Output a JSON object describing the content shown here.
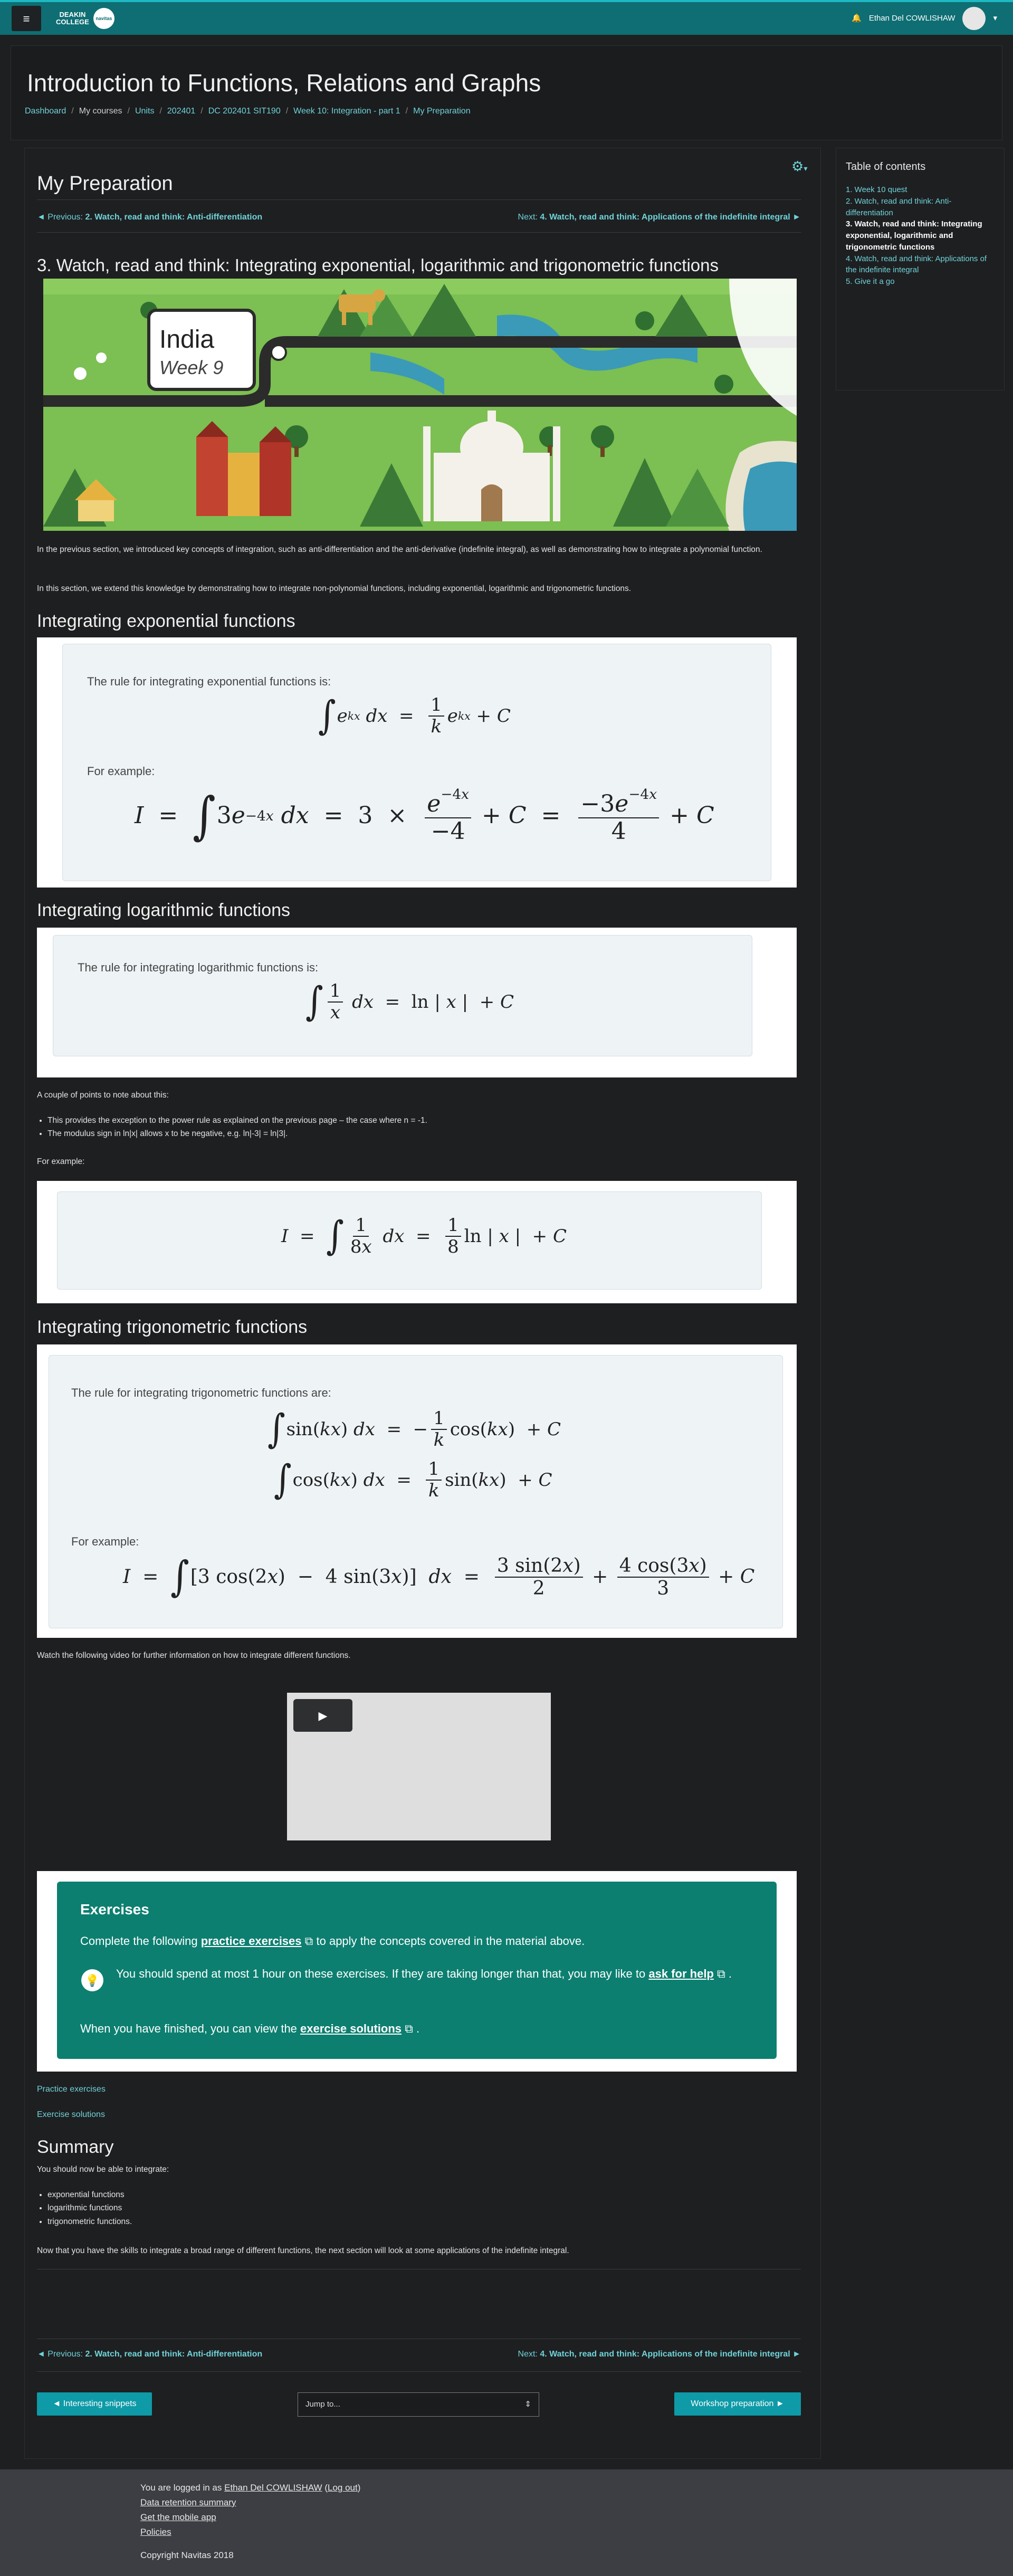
{
  "navbar": {
    "menu_icon": "hamburger-icon",
    "logo_line1": "DEAKIN",
    "logo_line2": "COLLEGE",
    "logo_badge": "navitas",
    "user_name": "Ethan Del COWLISHAW",
    "bell_icon": "bell-icon",
    "accent": "#0e6e73"
  },
  "header": {
    "title": "Introduction to Functions, Relations and Graphs",
    "breadcrumb": [
      "Dashboard",
      "My courses",
      "Units",
      "202401",
      "DC 202401 SIT190",
      "Week 10: Integration - part 1",
      "My Preparation"
    ]
  },
  "page": {
    "heading": "My Preparation",
    "prev_label": "◄ Previous:",
    "prev_title": "2. Watch, read and think: Anti-differentiation",
    "next_label": "Next:",
    "next_title": "4. Watch, read and think: Applications of the indefinite integral ►",
    "section_title": "3. Watch, read and think: Integrating exponential, logarithmic and trigonometric functions",
    "banner_title": "India",
    "banner_sub": "Week 9",
    "intro1": "In the previous section, we introduced key concepts of integration, such as anti-differentiation and the anti-derivative (indefinite integral), as well as demonstrating how to integrate a polynomial function.",
    "intro2": "In this section, we extend this knowledge by demonstrating how to integrate non-polynomial functions, including exponential, logarithmic and trigonometric functions."
  },
  "exp": {
    "heading": "Integrating exponential functions",
    "rule": "The rule for integrating exponential functions is:",
    "example": "For example:"
  },
  "log": {
    "heading": "Integrating logarithmic functions",
    "rule": "The rule for integrating logarithmic functions is:",
    "notes_intro": "A couple of points to note about this:",
    "bullet1": "This provides the exception to the power rule as explained on the previous page – the case where n = -1.",
    "bullet2": "The modulus sign in ln|x| allows x to be negative, e.g. ln|-3| = ln|3|.",
    "example": "For example:"
  },
  "trig": {
    "heading": "Integrating trigonometric functions",
    "rule": "The rule for integrating trigonometric functions are:",
    "example": "For example:",
    "video_intro": "Watch the following video for further information on how to integrate different functions."
  },
  "exercises": {
    "title": "Exercises",
    "line1_a": "Complete the following",
    "line1_link": "practice exercises",
    "line1_b": "to apply the concepts covered in the material above.",
    "tip_a": "You should spend at most 1 hour on these exercises. If they are taking longer than that, you may like to",
    "tip_link": "ask for",
    "tip_link2": "help",
    "line3_a": "When you have finished, you can view the",
    "line3_link": "exercise solutions",
    "color": "#0c7f70"
  },
  "links": {
    "practice": "Practice exercises",
    "solutions": "Exercise solutions"
  },
  "summary": {
    "heading": "Summary",
    "intro": "You should now be able to integrate:",
    "items": [
      "exponential functions",
      "logarithmic functions",
      "trigonometric functions."
    ],
    "outro": "Now that you have the skills to integrate a broad range of different functions, the next section will look at some applications of the indefinite integral."
  },
  "bottom_nav": {
    "prev_btn": "◄ Interesting snippets",
    "jump": "Jump to...",
    "next_btn": "Workshop preparation ►"
  },
  "sidebar": {
    "title": "Table of contents",
    "items": [
      "1. Week 10 quest",
      "2. Watch, read and think: Anti-differentiation",
      "3. Watch, read and think: Integrating exponential, logarithmic and trigonometric functions",
      "4. Watch, read and think: Applications of the indefinite integral",
      "5. Give it a go"
    ]
  },
  "footer": {
    "logged_a": "You are logged in as",
    "logged_user": "Ethan Del COWLISHAW",
    "logout": "Log out",
    "data_retention": "Data retention summary",
    "mobile_app": "Get the mobile app",
    "policies": "Policies",
    "copyright": "Copyright Navitas 2018"
  }
}
